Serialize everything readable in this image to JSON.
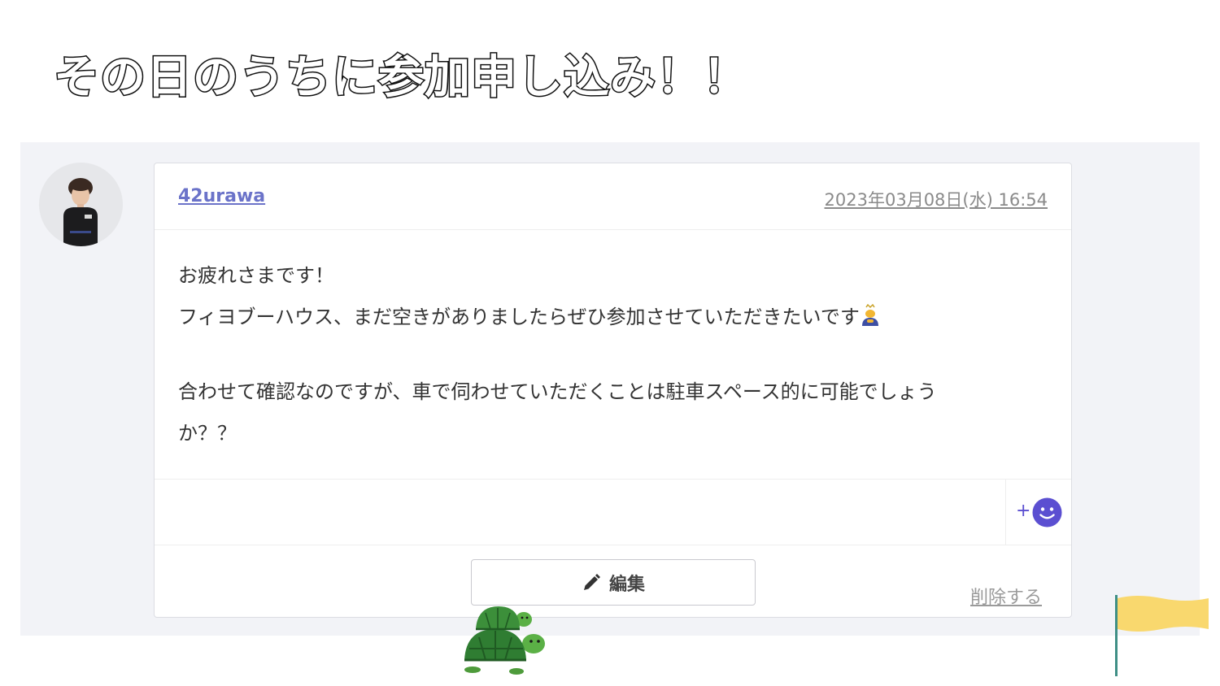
{
  "slide": {
    "title": "その日のうちに参加申し込み！！"
  },
  "post": {
    "author": "42urawa",
    "timestamp": "2023年03月08日(水) 16:54",
    "body": {
      "line1": "お疲れさまです！",
      "line2": "フィヨブーハウス、まだ空きがありましたらぜひ参加させていただきたいです",
      "line3": "合わせて確認なのですが、車で伺わせていただくことは駐車スペース的に可能でしょう",
      "line4": "か？？"
    },
    "reaction": {
      "plus": "+",
      "icon": "smiley-icon"
    },
    "actions": {
      "edit_label": "編集",
      "delete_label": "削除する"
    }
  },
  "colors": {
    "link": "#6b73c9",
    "reaction_accent": "#5b4fd1",
    "panel_background": "#f2f3f7",
    "flag": "#f9d86e"
  }
}
